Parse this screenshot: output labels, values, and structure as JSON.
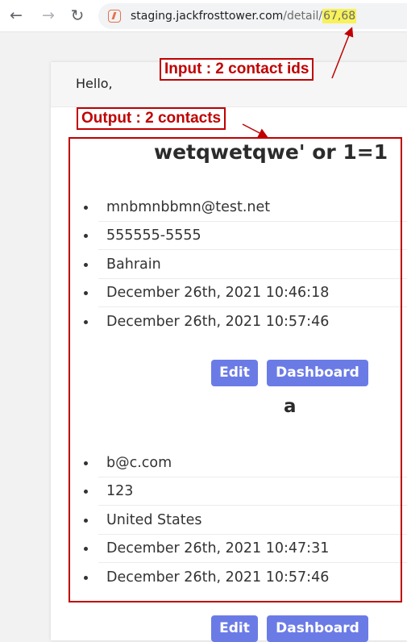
{
  "browser": {
    "back_icon": "←",
    "forward_icon": "→",
    "reload_icon": "↻",
    "site_icon": "bolt-favicon-icon",
    "url_host": "staging.jackfrosttower.com",
    "url_path": "/detail/",
    "url_ids": "67,68"
  },
  "page": {
    "greeting": "Hello,"
  },
  "contacts": [
    {
      "name": "wetqwetqwe' or 1=1",
      "fields": [
        "mnbmnbbmn@test.net",
        "555555-5555",
        "Bahrain",
        "December 26th, 2021 10:46:18",
        "December 26th, 2021 10:57:46"
      ],
      "edit_label": "Edit",
      "dashboard_label": "Dashboard"
    },
    {
      "name": "a",
      "fields": [
        "b@c.com",
        "123",
        "United States",
        "December 26th, 2021 10:47:31",
        "December 26th, 2021 10:57:46"
      ],
      "edit_label": "Edit",
      "dashboard_label": "Dashboard"
    }
  ],
  "annotations": {
    "input_label": "Input : 2 contact ids",
    "output_label": "Output : 2 contacts",
    "color": "#c00000",
    "highlight_color": "#f7f25a"
  },
  "colors": {
    "button": "#6b7be6"
  }
}
